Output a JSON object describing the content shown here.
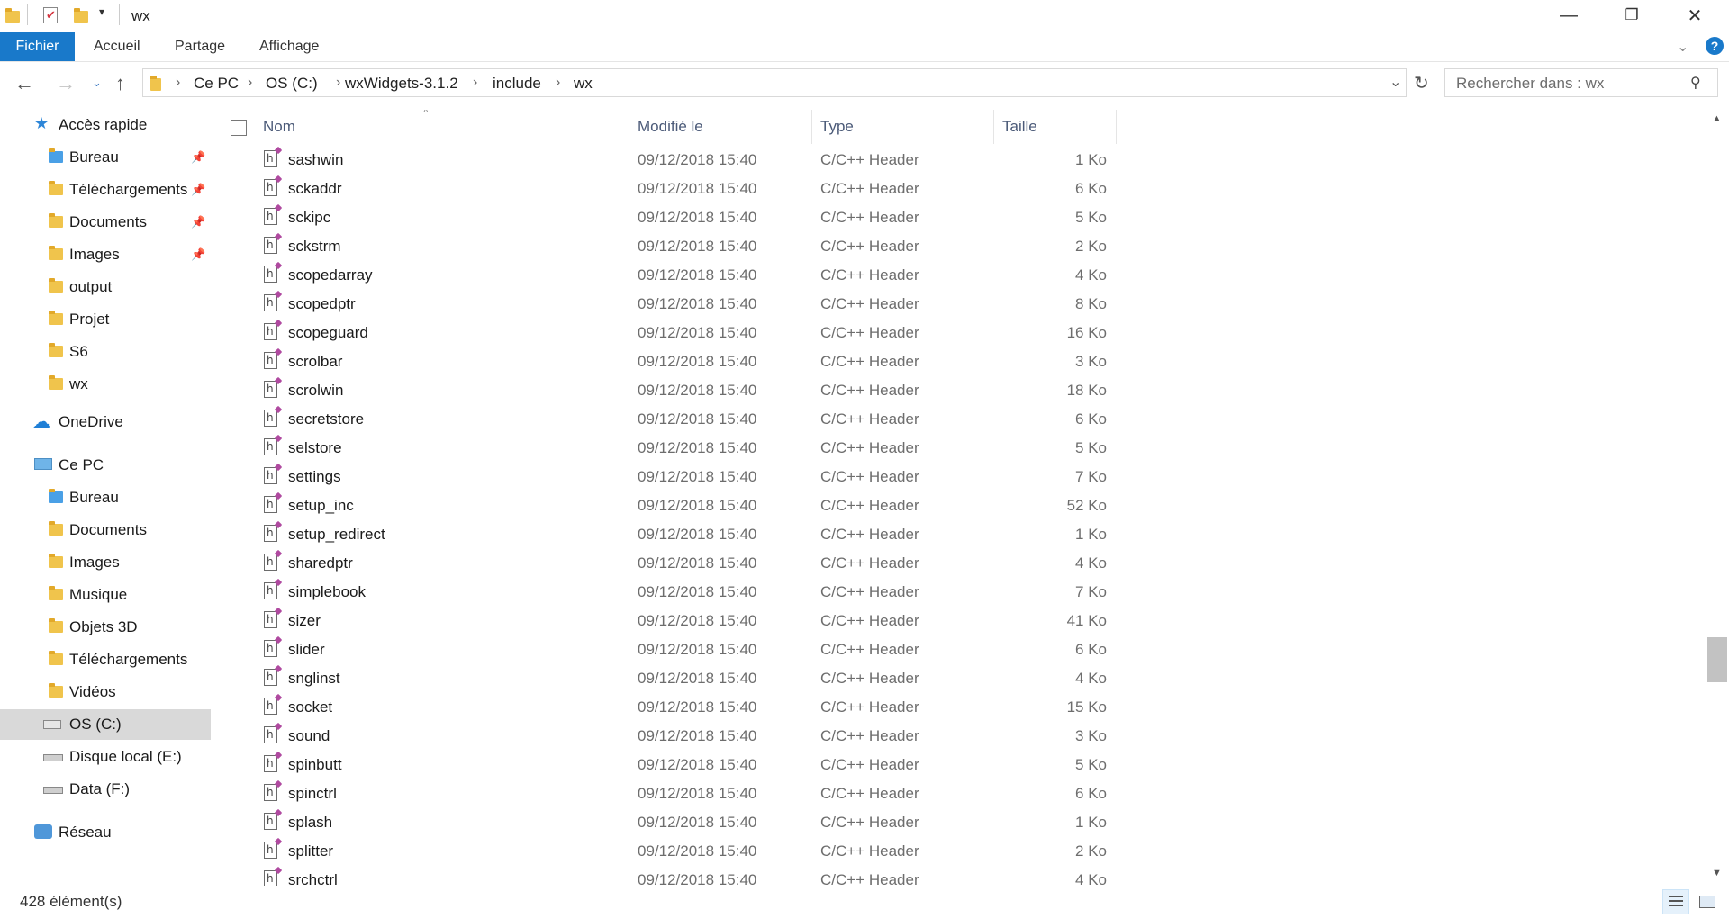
{
  "window": {
    "title": "wx",
    "controls": {
      "minimize": "—",
      "maximize": "❐",
      "close": "✕"
    }
  },
  "ribbon": {
    "tabs": [
      "Fichier",
      "Accueil",
      "Partage",
      "Affichage"
    ],
    "active_tab": "Fichier",
    "accent": "#1979ca"
  },
  "address": {
    "breadcrumbs": [
      "Ce PC",
      "OS (C:)",
      "wxWidgets-3.1.2",
      "include",
      "wx"
    ],
    "search_placeholder": "Rechercher dans : wx"
  },
  "nav": {
    "quick_access": {
      "label": "Accès rapide",
      "icon": "star-icon",
      "items": [
        {
          "label": "Bureau",
          "icon": "desktop-folder-icon",
          "pinned": true
        },
        {
          "label": "Téléchargements",
          "icon": "downloads-folder-icon",
          "pinned": true
        },
        {
          "label": "Documents",
          "icon": "documents-folder-icon",
          "pinned": true
        },
        {
          "label": "Images",
          "icon": "pictures-folder-icon",
          "pinned": true
        },
        {
          "label": "output",
          "icon": "folder-icon",
          "pinned": false
        },
        {
          "label": "Projet",
          "icon": "folder-icon",
          "pinned": false
        },
        {
          "label": "S6",
          "icon": "folder-icon",
          "pinned": false
        },
        {
          "label": "wx",
          "icon": "folder-icon",
          "pinned": false
        }
      ]
    },
    "onedrive": {
      "label": "OneDrive",
      "icon": "cloud-icon"
    },
    "this_pc": {
      "label": "Ce PC",
      "icon": "computer-icon",
      "items": [
        {
          "label": "Bureau",
          "icon": "desktop-folder-icon"
        },
        {
          "label": "Documents",
          "icon": "documents-folder-icon"
        },
        {
          "label": "Images",
          "icon": "pictures-folder-icon"
        },
        {
          "label": "Musique",
          "icon": "music-folder-icon"
        },
        {
          "label": "Objets 3D",
          "icon": "3d-objects-folder-icon"
        },
        {
          "label": "Téléchargements",
          "icon": "downloads-folder-icon"
        },
        {
          "label": "Vidéos",
          "icon": "videos-folder-icon"
        },
        {
          "label": "OS (C:)",
          "icon": "windows-drive-icon",
          "selected": true
        },
        {
          "label": "Disque local (E:)",
          "icon": "drive-icon"
        },
        {
          "label": "Data (F:)",
          "icon": "drive-icon"
        }
      ]
    },
    "network": {
      "label": "Réseau",
      "icon": "network-icon"
    }
  },
  "filelist": {
    "columns": {
      "name": "Nom",
      "modified": "Modifié le",
      "type": "Type",
      "size": "Taille"
    },
    "rows": [
      {
        "name": "sashwin",
        "date": "09/12/2018 15:40",
        "type": "C/C++ Header",
        "size": "1 Ko"
      },
      {
        "name": "sckaddr",
        "date": "09/12/2018 15:40",
        "type": "C/C++ Header",
        "size": "6 Ko"
      },
      {
        "name": "sckipc",
        "date": "09/12/2018 15:40",
        "type": "C/C++ Header",
        "size": "5 Ko"
      },
      {
        "name": "sckstrm",
        "date": "09/12/2018 15:40",
        "type": "C/C++ Header",
        "size": "2 Ko"
      },
      {
        "name": "scopedarray",
        "date": "09/12/2018 15:40",
        "type": "C/C++ Header",
        "size": "4 Ko"
      },
      {
        "name": "scopedptr",
        "date": "09/12/2018 15:40",
        "type": "C/C++ Header",
        "size": "8 Ko"
      },
      {
        "name": "scopeguard",
        "date": "09/12/2018 15:40",
        "type": "C/C++ Header",
        "size": "16 Ko"
      },
      {
        "name": "scrolbar",
        "date": "09/12/2018 15:40",
        "type": "C/C++ Header",
        "size": "3 Ko"
      },
      {
        "name": "scrolwin",
        "date": "09/12/2018 15:40",
        "type": "C/C++ Header",
        "size": "18 Ko"
      },
      {
        "name": "secretstore",
        "date": "09/12/2018 15:40",
        "type": "C/C++ Header",
        "size": "6 Ko"
      },
      {
        "name": "selstore",
        "date": "09/12/2018 15:40",
        "type": "C/C++ Header",
        "size": "5 Ko"
      },
      {
        "name": "settings",
        "date": "09/12/2018 15:40",
        "type": "C/C++ Header",
        "size": "7 Ko"
      },
      {
        "name": "setup_inc",
        "date": "09/12/2018 15:40",
        "type": "C/C++ Header",
        "size": "52 Ko"
      },
      {
        "name": "setup_redirect",
        "date": "09/12/2018 15:40",
        "type": "C/C++ Header",
        "size": "1 Ko"
      },
      {
        "name": "sharedptr",
        "date": "09/12/2018 15:40",
        "type": "C/C++ Header",
        "size": "4 Ko"
      },
      {
        "name": "simplebook",
        "date": "09/12/2018 15:40",
        "type": "C/C++ Header",
        "size": "7 Ko"
      },
      {
        "name": "sizer",
        "date": "09/12/2018 15:40",
        "type": "C/C++ Header",
        "size": "41 Ko"
      },
      {
        "name": "slider",
        "date": "09/12/2018 15:40",
        "type": "C/C++ Header",
        "size": "6 Ko"
      },
      {
        "name": "snglinst",
        "date": "09/12/2018 15:40",
        "type": "C/C++ Header",
        "size": "4 Ko"
      },
      {
        "name": "socket",
        "date": "09/12/2018 15:40",
        "type": "C/C++ Header",
        "size": "15 Ko"
      },
      {
        "name": "sound",
        "date": "09/12/2018 15:40",
        "type": "C/C++ Header",
        "size": "3 Ko"
      },
      {
        "name": "spinbutt",
        "date": "09/12/2018 15:40",
        "type": "C/C++ Header",
        "size": "5 Ko"
      },
      {
        "name": "spinctrl",
        "date": "09/12/2018 15:40",
        "type": "C/C++ Header",
        "size": "6 Ko"
      },
      {
        "name": "splash",
        "date": "09/12/2018 15:40",
        "type": "C/C++ Header",
        "size": "1 Ko"
      },
      {
        "name": "splitter",
        "date": "09/12/2018 15:40",
        "type": "C/C++ Header",
        "size": "2 Ko"
      },
      {
        "name": "srchctrl",
        "date": "09/12/2018 15:40",
        "type": "C/C++ Header",
        "size": "4 Ko"
      }
    ]
  },
  "status": {
    "item_count": "428 élément(s)"
  }
}
